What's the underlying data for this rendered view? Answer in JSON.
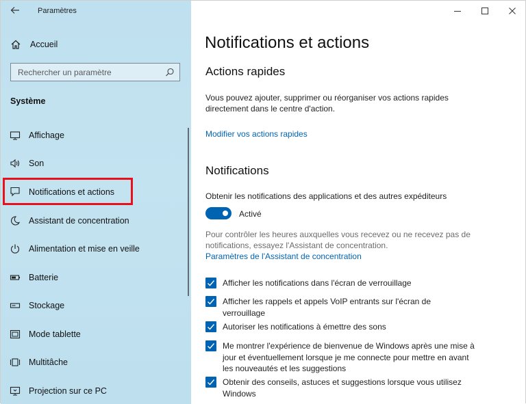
{
  "app": {
    "title": "Paramètres"
  },
  "sidebar": {
    "home_label": "Accueil",
    "search_placeholder": "Rechercher un paramètre",
    "section_title": "Système",
    "items": [
      {
        "label": "Affichage",
        "icon": "monitor-icon"
      },
      {
        "label": "Son",
        "icon": "speaker-icon"
      },
      {
        "label": "Notifications et actions",
        "icon": "notification-icon",
        "selected": true
      },
      {
        "label": "Assistant de concentration",
        "icon": "moon-icon"
      },
      {
        "label": "Alimentation et mise en veille",
        "icon": "power-icon"
      },
      {
        "label": "Batterie",
        "icon": "battery-icon"
      },
      {
        "label": "Stockage",
        "icon": "storage-icon"
      },
      {
        "label": "Mode tablette",
        "icon": "tablet-icon"
      },
      {
        "label": "Multitâche",
        "icon": "multitask-icon"
      },
      {
        "label": "Projection sur ce PC",
        "icon": "projection-icon"
      }
    ]
  },
  "main": {
    "page_title": "Notifications et actions",
    "quick_actions": {
      "title": "Actions rapides",
      "description_line1": "Vous pouvez ajouter, supprimer ou réorganiser vos actions rapides",
      "description_line2": "directement dans le centre d'action.",
      "link": "Modifier vos actions rapides"
    },
    "notifications": {
      "title": "Notifications",
      "toggle_caption": "Obtenir les notifications des applications et des autres expéditeurs",
      "toggle_state": "Activé",
      "toggle_on": true,
      "help_line1": "Pour contrôler les heures auxquelles vous recevez ou ne recevez pas de",
      "help_line2": "notifications, essayez l'Assistant de concentration.",
      "help_link": "Paramètres de l'Assistant de concentration",
      "checkboxes": [
        {
          "label": "Afficher les notifications dans l'écran de verrouillage",
          "checked": true
        },
        {
          "label": "Afficher les rappels et appels VoIP entrants sur l'écran de verrouillage",
          "checked": true
        },
        {
          "label": "Autoriser les notifications à émettre des sons",
          "checked": true
        },
        {
          "label": "Me montrer l'expérience de bienvenue de Windows après une mise à jour et éventuellement lorsque je me connecte pour mettre en avant les nouveautés et les suggestions",
          "checked": true
        },
        {
          "label": "Obtenir des conseils, astuces et suggestions lorsque vous utilisez Windows",
          "checked": true
        }
      ]
    }
  },
  "colors": {
    "accent": "#0063b1",
    "highlight_frame": "#e8101a",
    "sidebar_bg": "#c4e3f1"
  }
}
